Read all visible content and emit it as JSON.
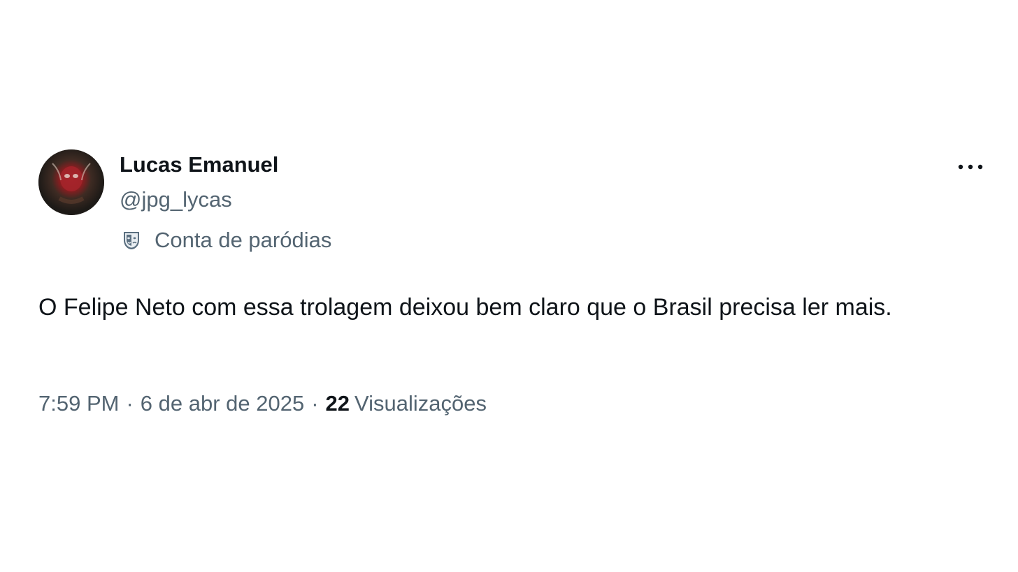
{
  "tweet": {
    "author": {
      "display_name": "Lucas Emanuel",
      "handle": "@jpg_lycas",
      "avatar_icon": "avatar-image"
    },
    "parody_label": "Conta de paródias",
    "parody_icon": "theater-mask-icon",
    "more_icon": "more-options-icon",
    "text": "O Felipe Neto com essa trolagem deixou bem claro que o Brasil precisa ler mais.",
    "time": "7:59 PM",
    "separator": "·",
    "date": "6 de abr de 2025",
    "views_count": "22",
    "views_label": "Visualizações"
  },
  "colors": {
    "primary_text": "#0f1419",
    "secondary_text": "#536471",
    "background": "#ffffff"
  }
}
